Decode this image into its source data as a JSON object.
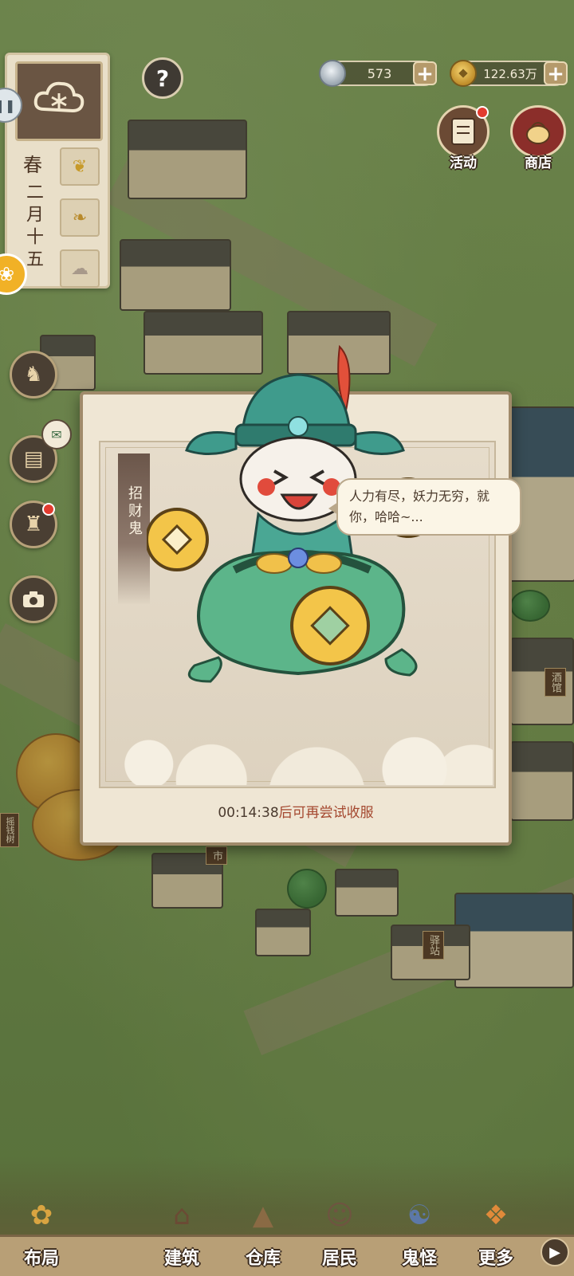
{
  "top_bar": {
    "silver_value": "573",
    "copper_value": "122.63万",
    "plus_label": "+"
  },
  "quick_buttons": {
    "help_label": "?",
    "events_label": "活动",
    "shop_label": "商店"
  },
  "calendar": {
    "season": "春",
    "date": "二月十五",
    "weather_icon": "snow-cloud-icon"
  },
  "map_signs": {
    "bar": "酒馆",
    "market": "市",
    "station": "驿站",
    "lucky_tree": "摇钱树"
  },
  "modal": {
    "ghost_name": "招财鬼",
    "speech": "人力有尽，妖力无穷，就你，哈哈~...",
    "timer": "00:14:38",
    "timer_suffix": "后可再尝试收服"
  },
  "bottom_nav": {
    "items": [
      {
        "label": "布局",
        "icon": "layout-icon"
      },
      {
        "label": "建筑",
        "icon": "building-icon"
      },
      {
        "label": "仓库",
        "icon": "warehouse-icon"
      },
      {
        "label": "居民",
        "icon": "resident-icon"
      },
      {
        "label": "鬼怪",
        "icon": "ghost-icon"
      },
      {
        "label": "更多",
        "icon": "more-icon"
      }
    ]
  },
  "colors": {
    "grass": "#7f9b56",
    "modal_bg": "#efe6d4",
    "name_tag": "#6b564a",
    "notification": "#e23b2f"
  }
}
